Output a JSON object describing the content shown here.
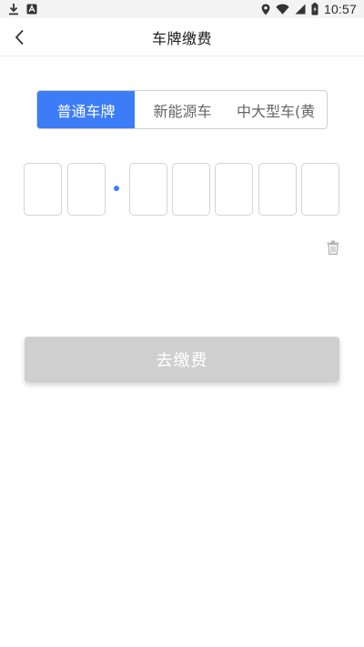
{
  "status_bar": {
    "time": "10:57",
    "icons": [
      "download-icon",
      "app-notification-icon",
      "location-icon",
      "wifi-icon",
      "cell-signal-icon",
      "battery-icon"
    ]
  },
  "header": {
    "title": "车牌缴费",
    "back_icon": "chevron-left-icon"
  },
  "plate_type_tabs": [
    {
      "label": "普通车牌",
      "selected": true
    },
    {
      "label": "新能源车",
      "selected": false
    },
    {
      "label": "中大型车(黄",
      "selected": false
    }
  ],
  "plate_input": {
    "slots": [
      "",
      "",
      "",
      "",
      "",
      "",
      ""
    ],
    "separator_color": "#3c7cf6"
  },
  "delete_icon": "trash-icon",
  "pay_button": {
    "label": "去缴费",
    "enabled": false
  },
  "colors": {
    "accent": "#3c7cf6",
    "disabled_button": "#cfcfcf"
  }
}
